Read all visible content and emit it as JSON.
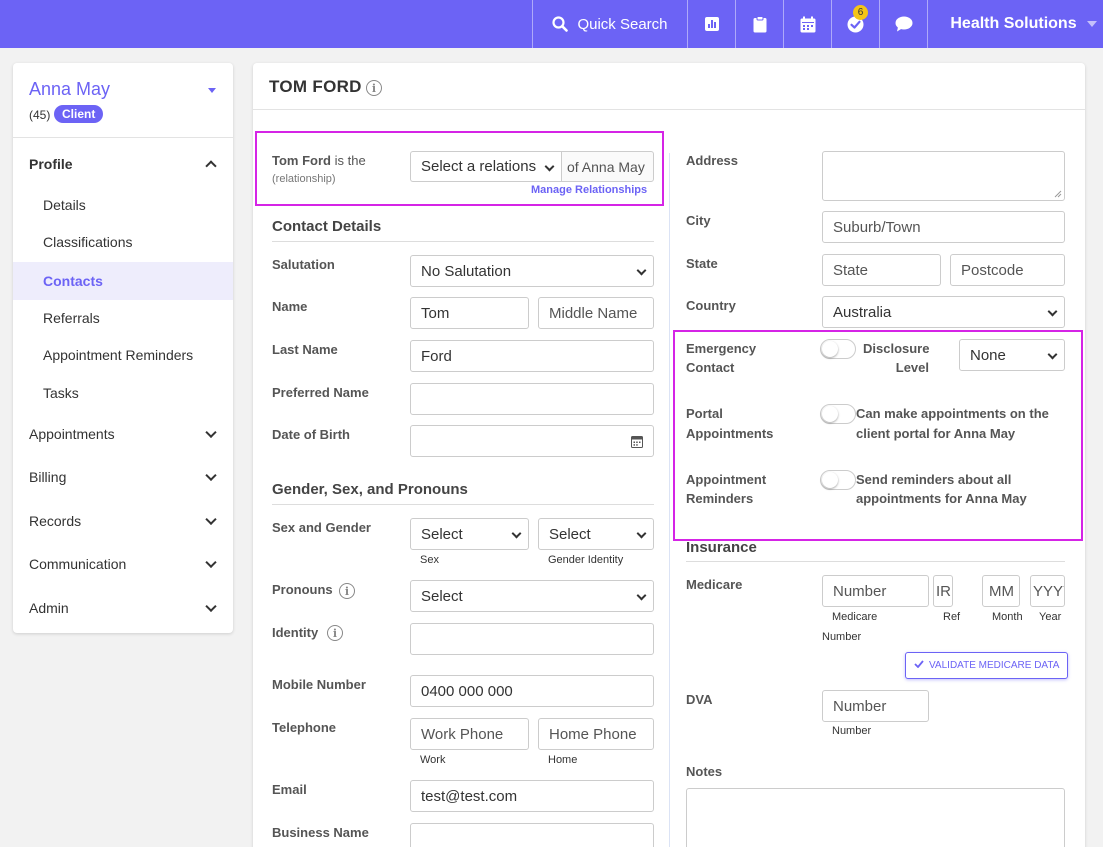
{
  "topbar": {
    "quick_search": "Quick Search",
    "tasks_badge": "6",
    "org_name": "Health Solutions",
    "icons": [
      "search-icon",
      "chart-icon",
      "clipboard-icon",
      "calendar-icon",
      "task-check-icon",
      "chat-icon"
    ]
  },
  "sidebar": {
    "client_name": "Anna May",
    "client_age": "(45)",
    "client_badge": "Client",
    "profile": "Profile",
    "sub_items": [
      "Details",
      "Classifications",
      "Contacts",
      "Referrals",
      "Appointment Reminders",
      "Tasks"
    ],
    "sections": [
      "Appointments",
      "Billing",
      "Records",
      "Communication",
      "Admin"
    ],
    "active": "Contacts"
  },
  "contact": {
    "title": "TOM FORD",
    "relationship": {
      "prefix_bold": "Tom Ford",
      "prefix_text": "is the",
      "sub": "(relationship)",
      "select_value": "Select a relations",
      "suffix": "of Anna May",
      "manage_link": "Manage Relationships"
    },
    "contact_details": {
      "heading": "Contact Details",
      "salutation_label": "Salutation",
      "salutation_value": "No Salutation",
      "name_label": "Name",
      "first_name": "Tom",
      "middle_name_ph": "Middle Name",
      "last_name_label": "Last Name",
      "last_name": "Ford",
      "preferred_name_label": "Preferred Name",
      "dob_label": "Date of Birth"
    },
    "gender": {
      "heading": "Gender, Sex, and Pronouns",
      "sex_gender_label": "Sex and Gender",
      "sex_value": "Select",
      "sex_sub": "Sex",
      "gender_value": "Select",
      "gender_sub": "Gender Identity",
      "pronouns_label": "Pronouns",
      "pronouns_value": "Select",
      "identity_label": "Identity"
    },
    "phones": {
      "mobile_label": "Mobile Number",
      "mobile_value": "0400 000 000",
      "telephone_label": "Telephone",
      "work_ph": "Work Phone",
      "work_sub": "Work",
      "home_ph": "Home Phone",
      "home_sub": "Home",
      "email_label": "Email",
      "email_value": "test@test.com",
      "business_label": "Business Name"
    },
    "address": {
      "address_label": "Address",
      "city_label": "City",
      "city_ph": "Suburb/Town",
      "state_label": "State",
      "state_ph": "State",
      "postcode_ph": "Postcode",
      "country_label": "Country",
      "country_value": "Australia"
    },
    "flags": {
      "emergency_label_1": "Emergency",
      "emergency_label_2": "Contact",
      "disclosure_label_1": "Disclosure",
      "disclosure_label_2": "Level",
      "disclosure_value": "None",
      "portal_label_1": "Portal",
      "portal_label_2": "Appointments",
      "portal_text_1": "Can make appointments on the",
      "portal_text_2": "client portal for Anna May",
      "reminders_label_1": "Appointment",
      "reminders_label_2": "Reminders",
      "reminders_text_1": "Send reminders about all",
      "reminders_text_2": "appointments for Anna May"
    },
    "insurance": {
      "heading": "Insurance",
      "medicare_label": "Medicare",
      "number_ph": "Number",
      "irn_ph": "IRN",
      "mm_ph": "MM",
      "yyyy_ph": "YYYY",
      "sub_medicare": "Medicare",
      "sub_number": "Number",
      "sub_ref": "Ref",
      "sub_month": "Month",
      "sub_year": "Year",
      "validate_btn": "VALIDATE MEDICARE DATA",
      "dva_label": "DVA",
      "dva_ph": "Number",
      "dva_sub": "Number",
      "notes_label": "Notes"
    }
  },
  "colors": {
    "accent": "#6c63f5",
    "highlight": "#d524e6"
  }
}
